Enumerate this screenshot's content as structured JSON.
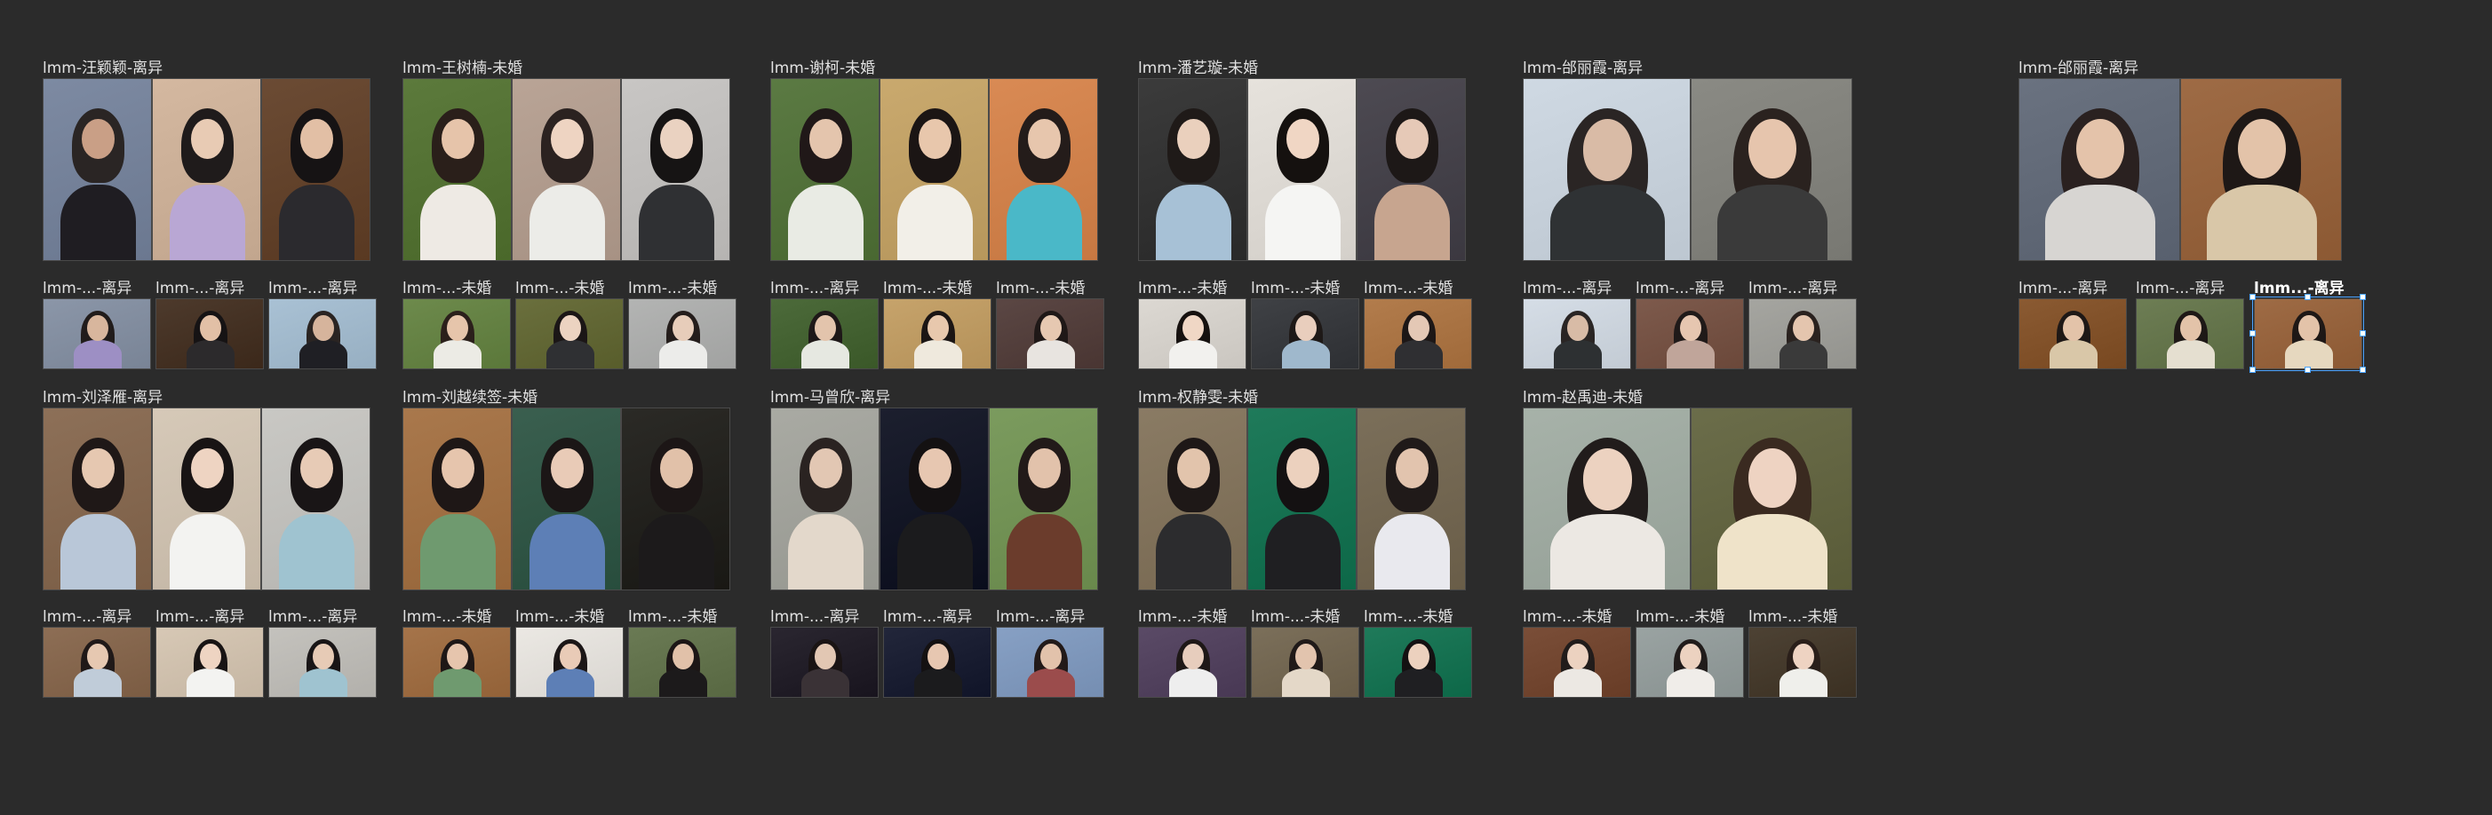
{
  "canvas": {
    "background": "#2b2b2b",
    "selection_color": "#4aa3ff"
  },
  "rows": [
    {
      "frames": [
        {
          "title": "lmm-汪颖颖-离异",
          "photos": 3,
          "palette": [
            [
              "#7d8aa2",
              "#2a2524",
              "#c99f86",
              "#1f1d22"
            ],
            [
              "#d4b8a0",
              "#1f1b1b",
              "#e8cbb4",
              "#b9a7d4"
            ],
            [
              "#6b4b34",
              "#161314",
              "#e2bfa5",
              "#2b2a2e"
            ]
          ]
        },
        {
          "title": "lmm-王树楠-未婚",
          "photos": 3,
          "palette": [
            [
              "#5c7a3c",
              "#2a1f1a",
              "#e6c4aa",
              "#eeeae4"
            ],
            [
              "#b9a496",
              "#2b2220",
              "#eed4c2",
              "#ecece8"
            ],
            [
              "#c8c6c4",
              "#161414",
              "#ead2c1",
              "#2f3033"
            ]
          ]
        },
        {
          "title": "lmm-谢柯-未婚",
          "photos": 3,
          "palette": [
            [
              "#5b7a43",
              "#201818",
              "#e4c5ad",
              "#e9ebe4"
            ],
            [
              "#c9a96e",
              "#1b1514",
              "#e8c7ac",
              "#f2efe8"
            ],
            [
              "#d98a54",
              "#241c1a",
              "#e7c6ad",
              "#4ab8c8"
            ]
          ]
        },
        {
          "title": "lmm-潘艺璇-未婚",
          "photos": 3,
          "palette": [
            [
              "#3b3b3b",
              "#1f1a18",
              "#ead0bd",
              "#a7c1d6"
            ],
            [
              "#e6e2dc",
              "#15110f",
              "#f0d6c4",
              "#f5f5f3"
            ],
            [
              "#4d4a52",
              "#1d1817",
              "#e6c9b7",
              "#c7a58f"
            ]
          ]
        },
        {
          "title": "lmm-邰丽霞-离异",
          "photos": 2,
          "palette": [
            [
              "#cfd9e3",
              "#2a2524",
              "#d9bba6",
              "#2f3234"
            ],
            [
              "#8a8a84",
              "#2a221f",
              "#e6c5ad",
              "#3a3a3a"
            ]
          ]
        },
        {
          "title": "lmm-邰丽霞-离异",
          "photos": 2,
          "palette": [
            [
              "#6a7280",
              "#2a2120",
              "#e4c3aa",
              "#d7d5d2"
            ],
            [
              "#9e6b45",
              "#1e1816",
              "#e3c3a9",
              "#d9c7a8"
            ]
          ]
        }
      ]
    },
    {
      "frames": [
        {
          "title": "lmm-...-离异",
          "photos": 1,
          "palette": [
            [
              "#8b96a8",
              "#211c1b",
              "#d8b69d",
              "#9d8fc4"
            ]
          ]
        },
        {
          "title": "lmm-...-离异",
          "photos": 1,
          "palette": [
            [
              "#4d3a2c",
              "#161314",
              "#e2c0a6",
              "#2c2a2c"
            ]
          ]
        },
        {
          "title": "lmm-...-离异",
          "photos": 1,
          "palette": [
            [
              "#a9c1d4",
              "#2a2422",
              "#d6b49c",
              "#1f1f24"
            ]
          ]
        },
        {
          "title": "lmm-...-未婚",
          "photos": 1,
          "palette": [
            [
              "#6d8a4c",
              "#2b201b",
              "#e6c5ab",
              "#ecebe5"
            ]
          ]
        },
        {
          "title": "lmm-...-未婚",
          "photos": 1,
          "palette": [
            [
              "#6a6f3d",
              "#1b1616",
              "#ecd3c1",
              "#2f3033"
            ]
          ]
        },
        {
          "title": "lmm-...-未婚",
          "photos": 1,
          "palette": [
            [
              "#b3b4b3",
              "#241d1b",
              "#e7cdba",
              "#ececea"
            ]
          ]
        },
        {
          "title": "lmm-...-离异",
          "photos": 1,
          "palette": [
            [
              "#4c6a3a",
              "#1e1818",
              "#e3c4ac",
              "#e6e8e1"
            ]
          ]
        },
        {
          "title": "lmm-...-未婚",
          "photos": 1,
          "palette": [
            [
              "#c6a36b",
              "#1b1514",
              "#e8c8ad",
              "#efe9dd"
            ]
          ]
        },
        {
          "title": "lmm-...-未婚",
          "photos": 1,
          "palette": [
            [
              "#5b4744",
              "#1f1817",
              "#e6c8b1",
              "#e8e4e0"
            ]
          ]
        },
        {
          "title": "lmm-...-未婚",
          "photos": 1,
          "palette": [
            [
              "#dcd8d2",
              "#16110f",
              "#f0d7c5",
              "#f2f1ee"
            ]
          ]
        },
        {
          "title": "lmm-...-未婚",
          "photos": 1,
          "palette": [
            [
              "#3f4145",
              "#1e1917",
              "#e9cebd",
              "#9fb8cc"
            ]
          ]
        },
        {
          "title": "lmm-...-未婚",
          "photos": 1,
          "palette": [
            [
              "#b27c4c",
              "#1d1716",
              "#e4c8b5",
              "#2f2f32"
            ]
          ]
        },
        {
          "title": "lmm-...-离异",
          "photos": 1,
          "palette": [
            [
              "#d5dde6",
              "#2a2524",
              "#d8bba6",
              "#2d3032"
            ]
          ]
        },
        {
          "title": "lmm-...-离异",
          "photos": 1,
          "palette": [
            [
              "#7d5a4c",
              "#201a19",
              "#e6c6b0",
              "#c0a59a"
            ]
          ]
        },
        {
          "title": "lmm-...-离异",
          "photos": 1,
          "palette": [
            [
              "#a5a5a0",
              "#2a221f",
              "#e4c5ae",
              "#3a3a3a"
            ]
          ]
        },
        {
          "title": "lmm-...-离异",
          "photos": 1,
          "palette": [
            [
              "#8a5a32",
              "#1e1816",
              "#e3c3a9",
              "#d9c7a8"
            ]
          ]
        },
        {
          "title": "lmm-...-离异",
          "photos": 1,
          "palette": [
            [
              "#6d7d54",
              "#1e1816",
              "#e3c3a9",
              "#e5dfd0"
            ]
          ]
        },
        {
          "title": "lmm...-离异",
          "photos": 1,
          "selected": true,
          "palette": [
            [
              "#9e6b45",
              "#1e1816",
              "#e3c3a9",
              "#e6d8bf"
            ]
          ]
        }
      ]
    },
    {
      "frames": [
        {
          "title": "lmm-刘泽雁-离异",
          "photos": 3,
          "palette": [
            [
              "#8d7058",
              "#1f1817",
              "#e6c8b1",
              "#b9c7d8"
            ],
            [
              "#d6c9b8",
              "#181414",
              "#eed4c2",
              "#f3f3f1"
            ],
            [
              "#c9c8c4",
              "#191516",
              "#e7cbb6",
              "#9fc3d0"
            ]
          ]
        },
        {
          "title": "lmm-刘越续签-未婚",
          "photos": 3,
          "palette": [
            [
              "#a9784c",
              "#1e1716",
              "#e6c5ad",
              "#6f9a6f"
            ],
            [
              "#3a5f4f",
              "#1b1616",
              "#e9cbb7",
              "#5d7fb6"
            ],
            [
              "#2b2a26",
              "#1c1616",
              "#e1c1a9",
              "#1c1a1b"
            ]
          ]
        },
        {
          "title": "lmm-马曾欣-离异",
          "photos": 3,
          "palette": [
            [
              "#a9aaa3",
              "#2a2321",
              "#e2c7b3",
              "#e3d8cb"
            ],
            [
              "#1c1f2e",
              "#141112",
              "#e7c7b1",
              "#1b1b1d"
            ],
            [
              "#7b9b5e",
              "#221a19",
              "#e2c2ab",
              "#6b3c2c"
            ]
          ]
        },
        {
          "title": "lmm-权静雯-未婚",
          "photos": 3,
          "palette": [
            [
              "#8a7b64",
              "#1e1817",
              "#e2c4ac",
              "#2c2c2e"
            ],
            [
              "#1f7a5a",
              "#141112",
              "#ecd1be",
              "#1f1f22"
            ],
            [
              "#7b6f5a",
              "#201a19",
              "#e2c4ae",
              "#e9e9ee"
            ]
          ]
        },
        {
          "title": "lmm-赵禹迪-未婚",
          "photos": 2,
          "palette": [
            [
              "#a7b2a9",
              "#211c1b",
              "#ecd2c0",
              "#ece8e3"
            ],
            [
              "#6b6d4a",
              "#3a2a20",
              "#eed3c2",
              "#efe3c9"
            ]
          ]
        }
      ]
    },
    {
      "frames": [
        {
          "title": "lmm-...-离异",
          "photos": 1,
          "palette": [
            [
              "#8d6e55",
              "#201918",
              "#e6c8b1",
              "#c0ccd9"
            ]
          ]
        },
        {
          "title": "lmm-...-离异",
          "photos": 1,
          "palette": [
            [
              "#d7c8b5",
              "#181414",
              "#eed4c2",
              "#f3f3f1"
            ]
          ]
        },
        {
          "title": "lmm-...-离异",
          "photos": 1,
          "palette": [
            [
              "#c4c2bd",
              "#191516",
              "#e7cbb6",
              "#9fc3d0"
            ]
          ]
        },
        {
          "title": "lmm-...-未婚",
          "photos": 1,
          "palette": [
            [
              "#a5744a",
              "#1e1716",
              "#e6c5ad",
              "#6f9a6f"
            ]
          ]
        },
        {
          "title": "lmm-...-未婚",
          "photos": 1,
          "palette": [
            [
              "#ebe8e3",
              "#1b1616",
              "#e9cbb7",
              "#5d7fb6"
            ]
          ]
        },
        {
          "title": "lmm-...-未婚",
          "photos": 1,
          "palette": [
            [
              "#6a7a54",
              "#1c1616",
              "#e1c1a9",
              "#1c1a1b"
            ]
          ]
        },
        {
          "title": "lmm-...-离异",
          "photos": 1,
          "palette": [
            [
              "#2a2630",
              "#1a1414",
              "#e2c7b3",
              "#3a3236"
            ]
          ]
        },
        {
          "title": "lmm-...-离异",
          "photos": 1,
          "palette": [
            [
              "#22263a",
              "#141112",
              "#e7c7b1",
              "#1b1b1d"
            ]
          ]
        },
        {
          "title": "lmm-...-离异",
          "photos": 1,
          "palette": [
            [
              "#87a0c4",
              "#221a19",
              "#e2c2ab",
              "#9b4c4c"
            ]
          ]
        },
        {
          "title": "lmm-...-未婚",
          "photos": 1,
          "palette": [
            [
              "#5a4a66",
              "#1e1817",
              "#e7cdbd",
              "#eeeeee"
            ]
          ]
        },
        {
          "title": "lmm-...-未婚",
          "photos": 1,
          "palette": [
            [
              "#7b6f5a",
              "#201a19",
              "#e2c4ae",
              "#e4d8c8"
            ]
          ]
        },
        {
          "title": "lmm-...-未婚",
          "photos": 1,
          "palette": [
            [
              "#1f7a5a",
              "#141112",
              "#ecd1be",
              "#1f1f22"
            ]
          ]
        },
        {
          "title": "lmm-...-未婚",
          "photos": 1,
          "palette": [
            [
              "#7a4e38",
              "#211c1b",
              "#ecd2c0",
              "#ece8e3"
            ]
          ]
        },
        {
          "title": "lmm-...-未婚",
          "photos": 1,
          "palette": [
            [
              "#9aa3a2",
              "#211c1b",
              "#ecd2c0",
              "#f0ede9"
            ]
          ]
        },
        {
          "title": "lmm-...-未婚",
          "photos": 1,
          "palette": [
            [
              "#4d4234",
              "#2a1f1a",
              "#eed3c2",
              "#efefeb"
            ]
          ]
        }
      ]
    }
  ]
}
